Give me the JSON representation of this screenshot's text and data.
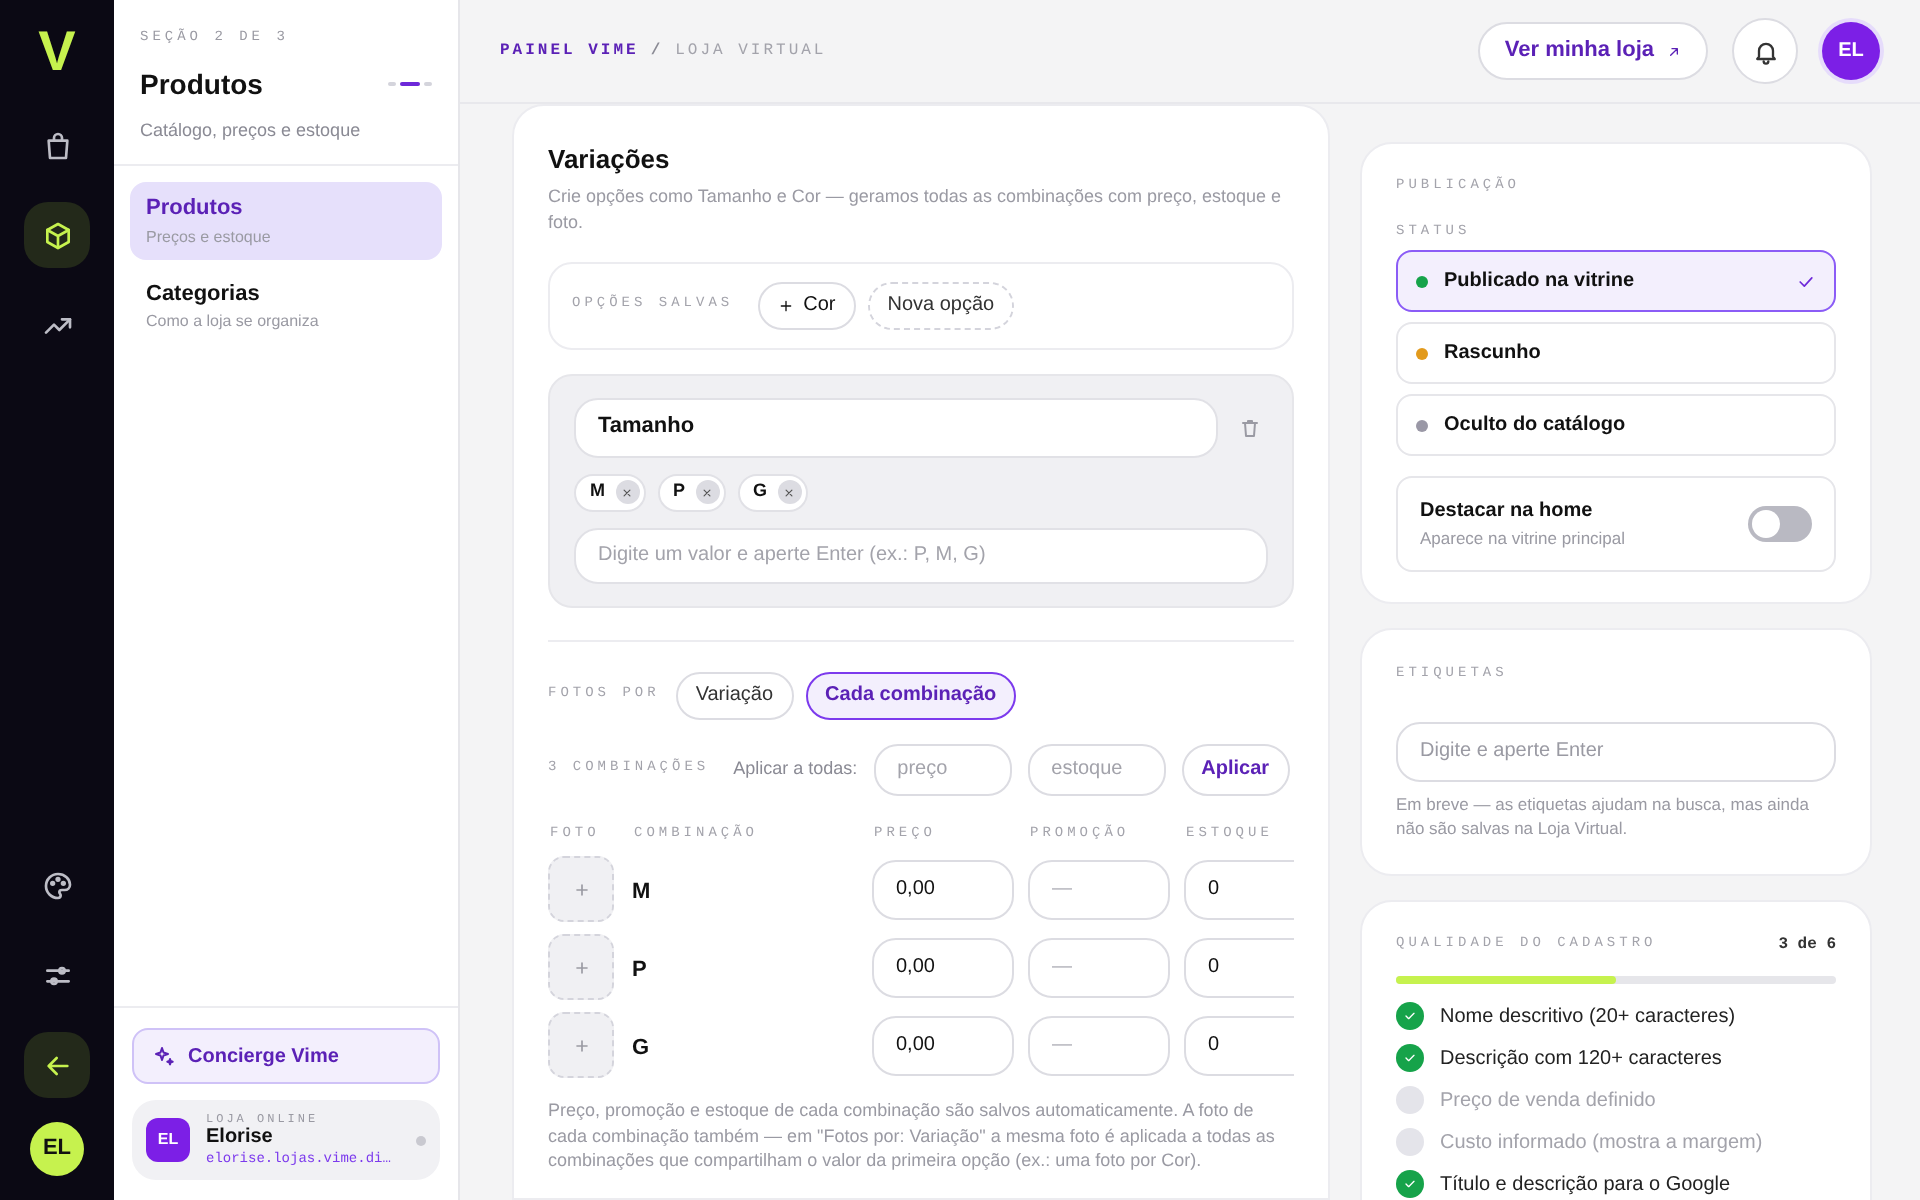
{
  "rail": {
    "logo": "V",
    "items": [
      {
        "kind": "bag",
        "selected": false
      },
      {
        "kind": "box",
        "selected": true
      },
      {
        "kind": "trend",
        "selected": false
      }
    ],
    "bottom_items": [
      {
        "kind": "palette",
        "selected": false
      },
      {
        "kind": "sliders",
        "selected": false
      },
      {
        "kind": "back",
        "selected": true
      }
    ],
    "avatar": "EL"
  },
  "sidebar": {
    "section": "SEÇÃO 2 DE 3",
    "title": "Produtos",
    "subtitle": "Catálogo, preços e estoque",
    "steps": [
      {
        "selected": false
      },
      {
        "selected": true
      },
      {
        "selected": false
      }
    ],
    "items": [
      {
        "label": "Produtos",
        "sublabel": "Preços e estoque",
        "selected": true
      },
      {
        "label": "Categorias",
        "sublabel": "Como a loja se organiza",
        "selected": false
      }
    ],
    "concierge": "Concierge Vime",
    "store": {
      "avatar": "EL",
      "label": "LOJA ONLINE",
      "name": "Elorise",
      "url": "elorise.lojas.vime.di…"
    }
  },
  "header": {
    "breadcrumb": [
      "PAINEL VIME",
      "LOJA VIRTUAL"
    ],
    "separator": "/",
    "button": "Ver minha loja",
    "avatar": "EL"
  },
  "variations": {
    "title": "Variações",
    "description": "Crie opções como Tamanho e Cor — geramos todas as combinações com preço, estoque e foto.",
    "saved_options": {
      "label": "OPÇÕES SALVAS",
      "chips": [
        {
          "kind": "add",
          "label": "Cor"
        },
        {
          "kind": "new",
          "label": "Nova opção"
        }
      ]
    },
    "option": {
      "name": "Tamanho",
      "values": [
        "M",
        "P",
        "G"
      ],
      "placeholder": "Digite um valor e aperte Enter (ex.: P, M, G)"
    },
    "photos_by": {
      "label": "FOTOS POR",
      "options": [
        {
          "label": "Variação",
          "selected": false
        },
        {
          "label": "Cada combinação",
          "selected": true
        }
      ]
    },
    "bulk": {
      "count": "3 COMBINAÇÕES",
      "label": "Aplicar a todas:",
      "placeholders": [
        "preço",
        "estoque"
      ],
      "button": "Aplicar"
    },
    "table": {
      "columns": [
        "FOTO",
        "COMBINAÇÃO",
        "PREÇO",
        "PROMOÇÃO",
        "ESTOQUE"
      ],
      "rows": [
        {
          "combination": "M",
          "price": "0,00",
          "promo_placeholder": "—",
          "stock": "0"
        },
        {
          "combination": "P",
          "price": "0,00",
          "promo_placeholder": "—",
          "stock": "0"
        },
        {
          "combination": "G",
          "price": "0,00",
          "promo_placeholder": "—",
          "stock": "0"
        }
      ]
    },
    "note": "Preço, promoção e estoque de cada combinação são salvos automaticamente. A foto de cada combinação também — em \"Fotos por: Variação\" a mesma foto é aplicada a todas as combinações que compartilham o valor da primeira opção (ex.: uma foto por Cor)."
  },
  "publication": {
    "label": "PUBLICAÇÃO",
    "status_label": "STATUS",
    "statuses": [
      {
        "label": "Publicado na vitrine",
        "color": "#16a34a",
        "selected": true
      },
      {
        "label": "Rascunho",
        "color": "#e29a1c",
        "selected": false
      },
      {
        "label": "Oculto do catálogo",
        "color": "#9a98a6",
        "selected": false
      }
    ],
    "highlight": {
      "title": "Destacar na home",
      "subtitle": "Aparece na vitrine principal",
      "on": false
    }
  },
  "tags": {
    "label": "ETIQUETAS",
    "placeholder": "Digite e aperte Enter",
    "note": "Em breve — as etiquetas ajudam na busca, mas ainda não são salvas na Loja Virtual."
  },
  "quality": {
    "label": "QUALIDADE DO CADASTRO",
    "count": "3 de 6",
    "level": 0.5,
    "items": [
      {
        "label": "Nome descritivo (20+ caracteres)",
        "done": true
      },
      {
        "label": "Descrição com 120+ caracteres",
        "done": true
      },
      {
        "label": "Preço de venda definido",
        "done": false
      },
      {
        "label": "Custo informado (mostra a margem)",
        "done": false
      },
      {
        "label": "Título e descrição para o Google",
        "done": true
      }
    ]
  }
}
